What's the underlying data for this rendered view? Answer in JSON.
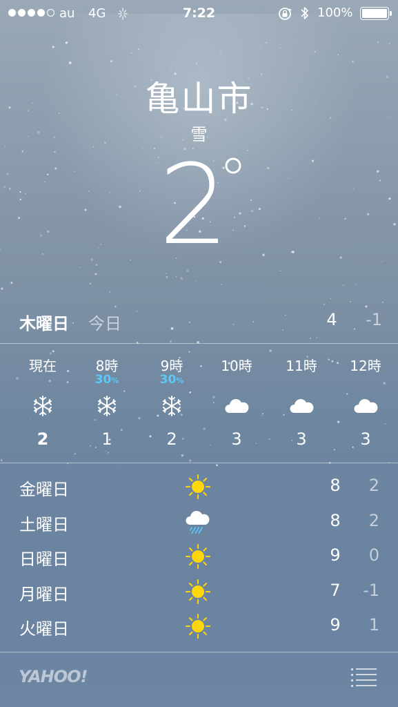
{
  "status_bar": {
    "carrier": "au",
    "network": "4G",
    "time": "7:22",
    "battery": "100%",
    "signal_bars_filled": 4,
    "signal_bars_total": 5
  },
  "location": {
    "city": "亀山市",
    "condition": "雪",
    "temperature": "2°"
  },
  "today": {
    "day": "木曜日",
    "label": "今日",
    "high": "4",
    "low": "-1"
  },
  "hourly": [
    {
      "time": "現在",
      "pop": "",
      "icon": "snowflake-icon",
      "temp": "2",
      "bold": true
    },
    {
      "time": "8時",
      "pop": "30",
      "icon": "snowflake-icon",
      "temp": "1"
    },
    {
      "time": "9時",
      "pop": "30",
      "icon": "snowflake-icon",
      "temp": "2"
    },
    {
      "time": "10時",
      "pop": "",
      "icon": "cloud-icon",
      "temp": "3"
    },
    {
      "time": "11時",
      "pop": "",
      "icon": "cloud-icon",
      "temp": "3"
    },
    {
      "time": "12時",
      "pop": "",
      "icon": "cloud-icon",
      "temp": "3"
    }
  ],
  "pop_unit": "%",
  "daily": [
    {
      "day": "金曜日",
      "icon": "sun-icon",
      "high": "8",
      "low": "2"
    },
    {
      "day": "土曜日",
      "icon": "rain-cloud-icon",
      "high": "8",
      "low": "2"
    },
    {
      "day": "日曜日",
      "icon": "sun-icon",
      "high": "9",
      "low": "0"
    },
    {
      "day": "月曜日",
      "icon": "sun-icon",
      "high": "7",
      "low": "-1"
    },
    {
      "day": "火曜日",
      "icon": "sun-icon",
      "high": "9",
      "low": "1"
    }
  ],
  "footer": {
    "provider": "YAHOO!",
    "list_icon": "list-icon"
  },
  "colors": {
    "pop": "#5ac8fa",
    "sun": "#ffd60a",
    "rain": "#5ac8fa"
  }
}
